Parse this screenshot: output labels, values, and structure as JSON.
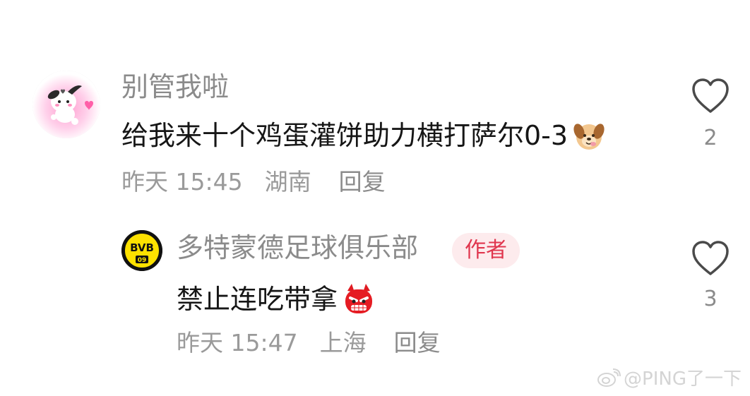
{
  "comments": [
    {
      "username": "别管我啦",
      "text": "给我来十个鸡蛋灌饼助力横打萨尔0-3",
      "emoji": "dog-emoji",
      "time": "昨天 15:45",
      "location": "湖南",
      "reply_label": "回复",
      "likes": "2",
      "avatar": "pochacco-avatar"
    },
    {
      "username": "多特蒙德足球俱乐部",
      "badge": "作者",
      "text": "禁止连吃带拿",
      "emoji": "angry-devil-emoji",
      "time": "昨天 15:47",
      "location": "上海",
      "reply_label": "回复",
      "likes": "3",
      "avatar": "bvb-logo-avatar",
      "logo_text": "BVB",
      "logo_number": "09"
    }
  ],
  "watermark": {
    "text": "@PING了一下",
    "icon": "weibo-icon"
  },
  "colors": {
    "username": "#8b8b8b",
    "text": "#161616",
    "meta": "#9a9a9a",
    "badge_bg": "#fdebed",
    "badge_text": "#e0364e",
    "bvb_yellow": "#fde100"
  }
}
